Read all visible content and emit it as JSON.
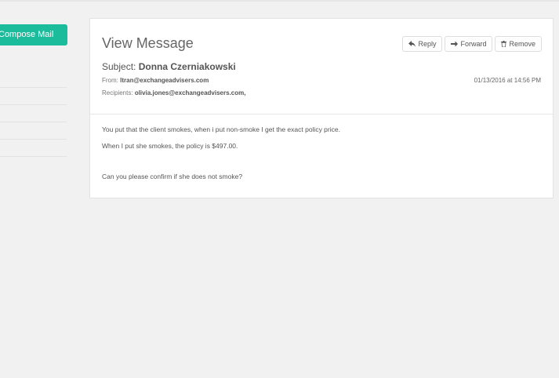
{
  "sidebar": {
    "compose_label": "Compose Mail"
  },
  "message": {
    "heading": "View Message",
    "actions": {
      "reply": "Reply",
      "forward": "Forward",
      "remove": "Remove"
    },
    "subject_label": "Subject:",
    "subject": "Donna Czerniakowski",
    "from_label": "From:",
    "from": "ltran@exchangeadvisers.com",
    "recipients_label": "Recipients:",
    "recipients": "olivia.jones@exchangeadvisers.com,",
    "date": "01/13/2016 at 14:56 PM",
    "body": [
      "You put that the client smokes, when i put non-smoke I get the exact policy price.",
      "When I put she smokes, the policy is $497.00.",
      "Can you please confirm if she does not smoke?"
    ]
  },
  "colors": {
    "accent": "#1abc9c",
    "background": "#f1f1f1",
    "panel": "#ffffff"
  },
  "icons": {
    "reply": "reply-arrow-icon",
    "forward": "forward-arrow-icon",
    "remove": "trash-icon"
  }
}
